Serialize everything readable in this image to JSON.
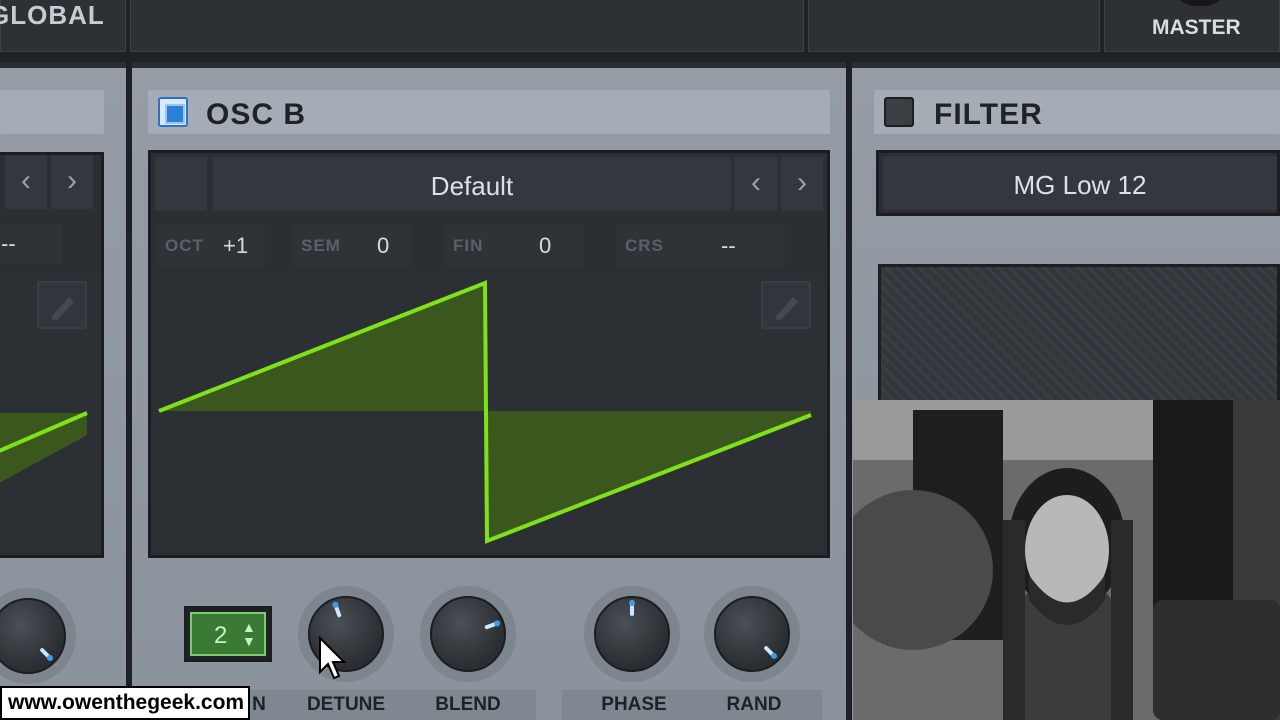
{
  "top": {
    "global_label": "GLOBAL",
    "master_label": "MASTER"
  },
  "osc_b": {
    "title": "OSC B",
    "preset": "Default",
    "prev_arrow": "‹",
    "next_arrow": "›",
    "params": [
      {
        "label": "OCT",
        "value": "+1"
      },
      {
        "label": "SEM",
        "value": "0"
      },
      {
        "label": "FIN",
        "value": "0"
      },
      {
        "label": "CRS",
        "value": "--"
      }
    ],
    "unison_value": "2",
    "unison_arrows": "▲▼",
    "knobs": [
      {
        "label": "N",
        "rotation_deg": -20
      },
      {
        "label": "DETUNE",
        "rotation_deg": -20
      },
      {
        "label": "BLEND",
        "rotation_deg": 70
      },
      {
        "label": "PHASE",
        "rotation_deg": 0
      },
      {
        "label": "RAND",
        "rotation_deg": 135
      }
    ],
    "wave_color": "#7fe219"
  },
  "osc_a": {
    "param_value": "--",
    "left_knob_rotation": 135
  },
  "filter": {
    "title": "FILTER",
    "type": "MG Low 12"
  },
  "watermark": "www.owenthegeek.com"
}
